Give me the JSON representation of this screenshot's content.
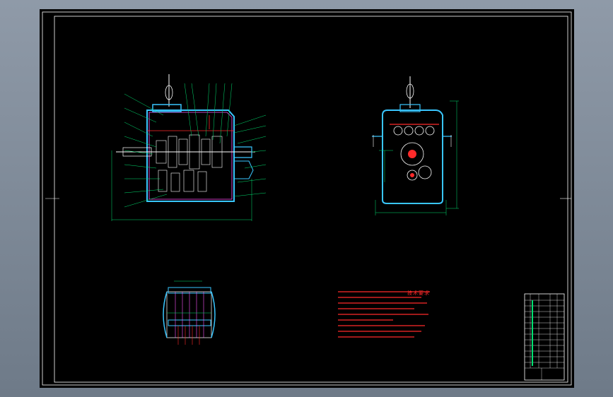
{
  "viewport": {
    "background": "#000000",
    "frame_color": "#ffffff"
  },
  "colors": {
    "housing": "#39c6ff",
    "section": "#ff55ff",
    "line": "#ffffff",
    "dimension": "#00e070",
    "note": "#ff2a2a",
    "gear_fill": "#ff2a2a",
    "title_block": "#ffffff"
  },
  "drawing": {
    "views": [
      "front-section-view",
      "side-section-view",
      "detail-section-view"
    ],
    "technical_notes_title": "技术要求",
    "technical_notes_count": 8,
    "title_block_rows": 14
  }
}
